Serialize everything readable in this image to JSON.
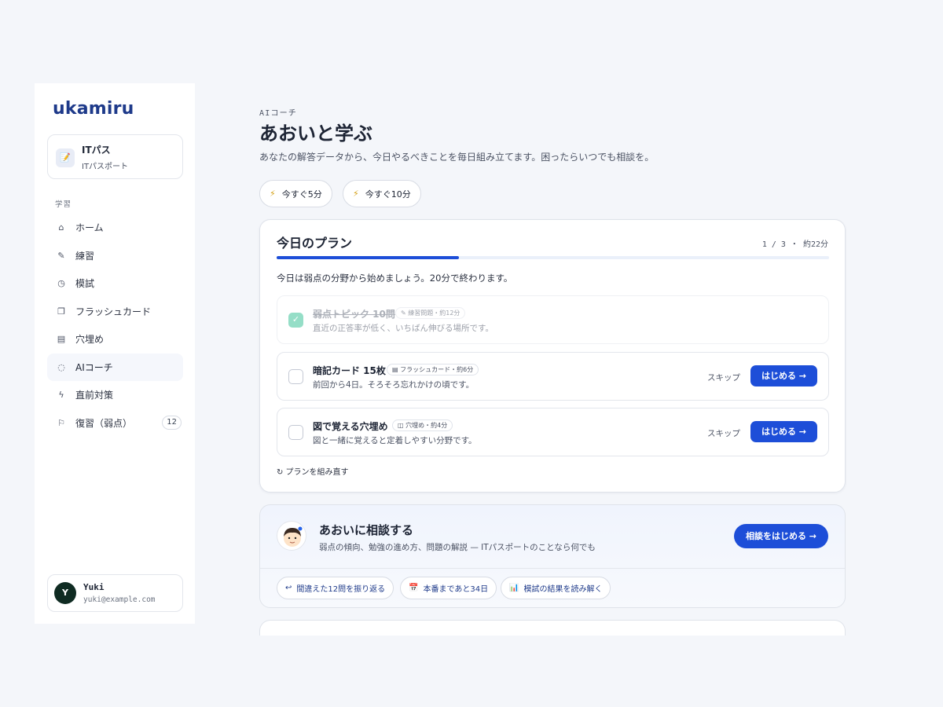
{
  "app": {
    "logo": "ukamiru"
  },
  "course": {
    "title": "ITパス",
    "subtitle": "ITパスポート",
    "icon": "memo-icon"
  },
  "sidebar": {
    "section_label": "学習",
    "items": [
      {
        "label": "ホーム",
        "icon": "home-icon",
        "glyph": "⌂"
      },
      {
        "label": "練習",
        "icon": "pencil-icon",
        "glyph": "✎"
      },
      {
        "label": "模試",
        "icon": "timer-icon",
        "glyph": "◷"
      },
      {
        "label": "フラッシュカード",
        "icon": "cards-icon",
        "glyph": "❐"
      },
      {
        "label": "穴埋め",
        "icon": "document-icon",
        "glyph": "▤"
      },
      {
        "label": "AIコーチ",
        "icon": "chat-icon",
        "glyph": "◌",
        "active": true
      },
      {
        "label": "直前対策",
        "icon": "lightning-icon",
        "glyph": "ϟ"
      },
      {
        "label": "復習（弱点）",
        "icon": "flag-icon",
        "glyph": "⚐",
        "badge": "12"
      }
    ]
  },
  "user": {
    "initial": "Y",
    "name": "Yuki",
    "email": "yuki@example.com"
  },
  "header": {
    "eyebrow": "AIコーチ",
    "title": "あおいと学ぶ",
    "description": "あなたの解答データから、今日やるべきことを毎日組み立てます。困ったらいつでも相談を。"
  },
  "quick_actions": [
    {
      "label": "今すぐ5分",
      "icon": "lightning-icon"
    },
    {
      "label": "今すぐ10分",
      "icon": "lightning-icon"
    }
  ],
  "plan": {
    "title": "今日のプラン",
    "meta": "1 / 3 ・ 約22分",
    "progress_fraction": 0.33,
    "intro": "今日は弱点の分野から始めましょう。20分で終わります。",
    "tasks": [
      {
        "title": "弱点トピック 10問",
        "tag": "✎ 練習問題・約12分",
        "desc": "直近の正答率が低く、いちばん伸びる場所です。",
        "done": true
      },
      {
        "title": "暗記カード 15枚",
        "tag": "▤ フラッシュカード・約6分",
        "desc": "前回から4日。そろそろ忘れかけの頃です。",
        "done": false,
        "skip": "スキップ",
        "start": "はじめる →"
      },
      {
        "title": "図で覚える穴埋め",
        "tag": "◫ 穴埋め・約4分",
        "desc": "図と一緒に覚えると定着しやすい分野です。",
        "done": false,
        "skip": "スキップ",
        "start": "はじめる →"
      }
    ],
    "replan": "↻ プランを組み直す"
  },
  "coach": {
    "title": "あおいに相談する",
    "subtitle": "弱点の傾向、勉強の進め方、問題の解説 — ITパスポートのことなら何でも",
    "button": "相談をはじめる →",
    "chips": [
      {
        "label": "間違えた12問を振り返る",
        "icon": "return-icon",
        "glyph": "↩"
      },
      {
        "label": "本番まであと34日",
        "icon": "calendar-icon",
        "glyph": "📅"
      },
      {
        "label": "模試の結果を読み解く",
        "icon": "chart-icon",
        "glyph": "📊"
      }
    ]
  },
  "colors": {
    "accent": "#1d4ed8",
    "done_check": "#3fc49a",
    "brand": "#1e3a8a"
  }
}
